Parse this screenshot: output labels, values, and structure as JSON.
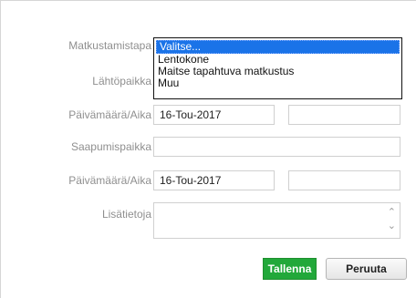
{
  "form": {
    "labels": {
      "travel_mode": "Matkustamistapa",
      "departure_place": "Lähtöpaikka",
      "departure_datetime": "Päivämäärä/Aika",
      "arrival_place": "Saapumispaikka",
      "arrival_datetime": "Päivämäärä/Aika",
      "additional_info": "Lisätietoja"
    },
    "travel_mode_options": [
      "Valitse...",
      "Lentokone",
      "Maitse tapahtuva matkustus",
      "Muu"
    ],
    "travel_mode_selected": "Valitse...",
    "departure_date": "16-Tou-2017",
    "departure_time": "",
    "arrival_place": "",
    "arrival_date": "16-Tou-2017",
    "arrival_time": "",
    "additional_info": ""
  },
  "buttons": {
    "save": "Tallenna",
    "cancel": "Peruuta"
  },
  "colors": {
    "save_button": "#22a83a",
    "dropdown_highlight": "#1a73e8"
  }
}
